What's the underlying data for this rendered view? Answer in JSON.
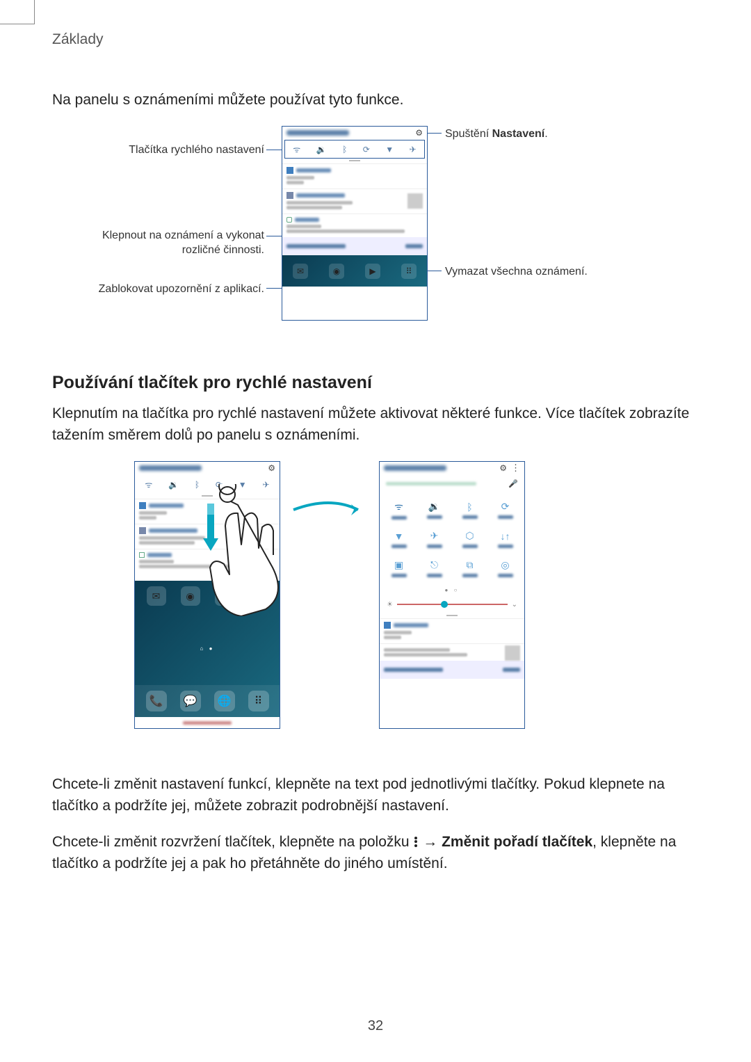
{
  "header": {
    "section": "Základy"
  },
  "intro": "Na panelu s oznámeními můžete používat tyto funkce.",
  "fig1": {
    "left": {
      "quick": "Tlačítka rychlého nastavení",
      "tap": "Klepnout na oznámení a vykonat rozličné činnosti.",
      "block": "Zablokovat upozornění z aplikací."
    },
    "right": {
      "settings_pre": "Spuštění ",
      "settings_bold": "Nastavení",
      "settings_post": ".",
      "clear": "Vymazat všechna oznámení."
    }
  },
  "h2": "Používání tlačítek pro rychlé nastavení",
  "p2": "Klepnutím na tlačítka pro rychlé nastavení můžete aktivovat některé funkce. Více tlačítek zobrazíte tažením směrem dolů po panelu s oznámeními.",
  "p3a": "Chcete-li změnit nastavení funkcí, klepněte na text pod jednotlivými tlačítky. Pokud klepnete na tlačítko a podržíte jej, můžete zobrazit podrobnější nastavení.",
  "p4_pre": "Chcete-li změnit rozvržení tlačítek, klepněte na položku ",
  "p4_arrow": " → ",
  "p4_bold": "Změnit pořadí tlačítek",
  "p4_post": ", klepněte na tlačítko a podržíte jej a pak ho přetáhněte do jiného umístění.",
  "page": "32"
}
